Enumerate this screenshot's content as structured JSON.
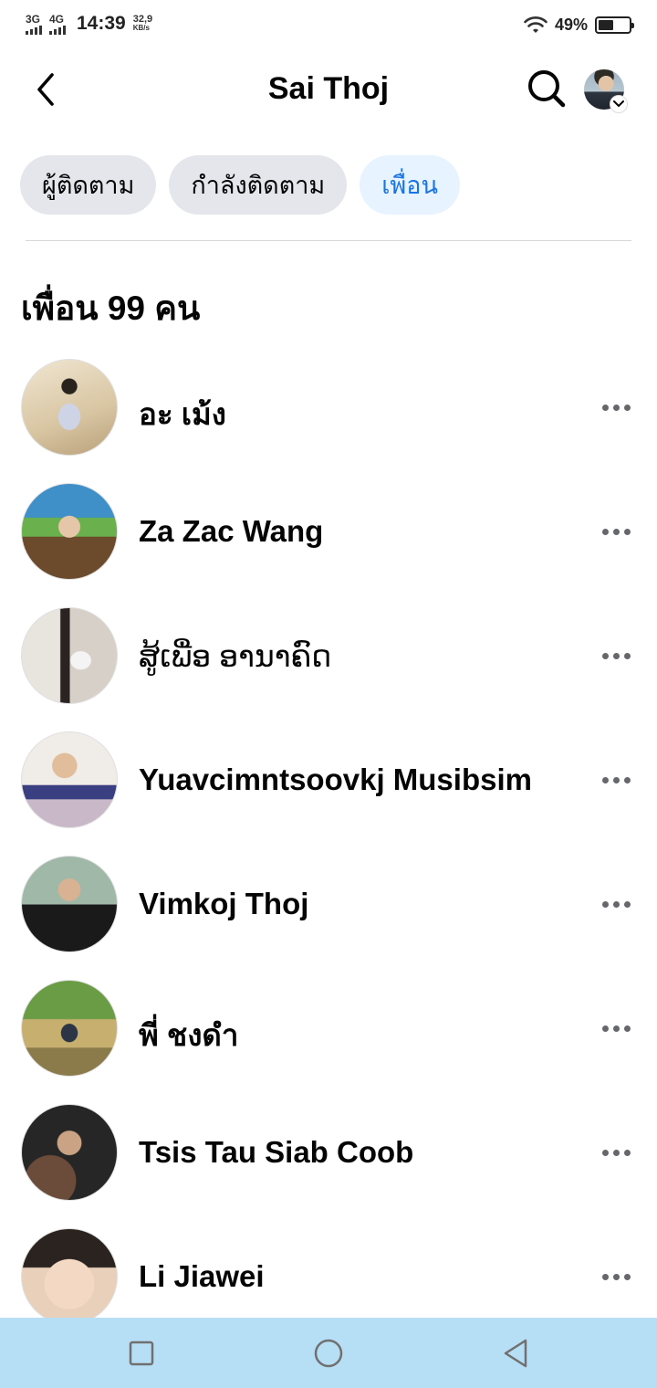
{
  "status_bar": {
    "network_1": "3G",
    "network_2": "4G",
    "time": "14:39",
    "speed_value": "32,9",
    "speed_unit": "KB/s",
    "battery": "49%",
    "battery_level": 0.49
  },
  "header": {
    "title": "Sai Thoj",
    "back_icon": "chevron-left-icon",
    "search_icon": "search-icon"
  },
  "tabs": [
    {
      "label": "ผู้ติดตาม",
      "active": false
    },
    {
      "label": "กำลังติดตาม",
      "active": false
    },
    {
      "label": "เพื่อน",
      "active": true
    }
  ],
  "section_title": "เพื่อน 99 คน",
  "friends": [
    {
      "name": "อะ เม้ง"
    },
    {
      "name": "Za Zac Wang"
    },
    {
      "name": "ສູ້ເພື່ອ ອານາຄົດ"
    },
    {
      "name": "Yuavcimntsoovkj Musibsim"
    },
    {
      "name": "Vimkoj Thoj"
    },
    {
      "name": "พี่ ชงดำ"
    },
    {
      "name": "Tsis Tau Siab Coob"
    },
    {
      "name": "Li Jiawei"
    }
  ],
  "colors": {
    "accent": "#1b74e4",
    "active_tab_bg": "#e7f3ff",
    "inactive_tab_bg": "#e4e6eb",
    "nav_bar_bg": "#b6def5"
  }
}
